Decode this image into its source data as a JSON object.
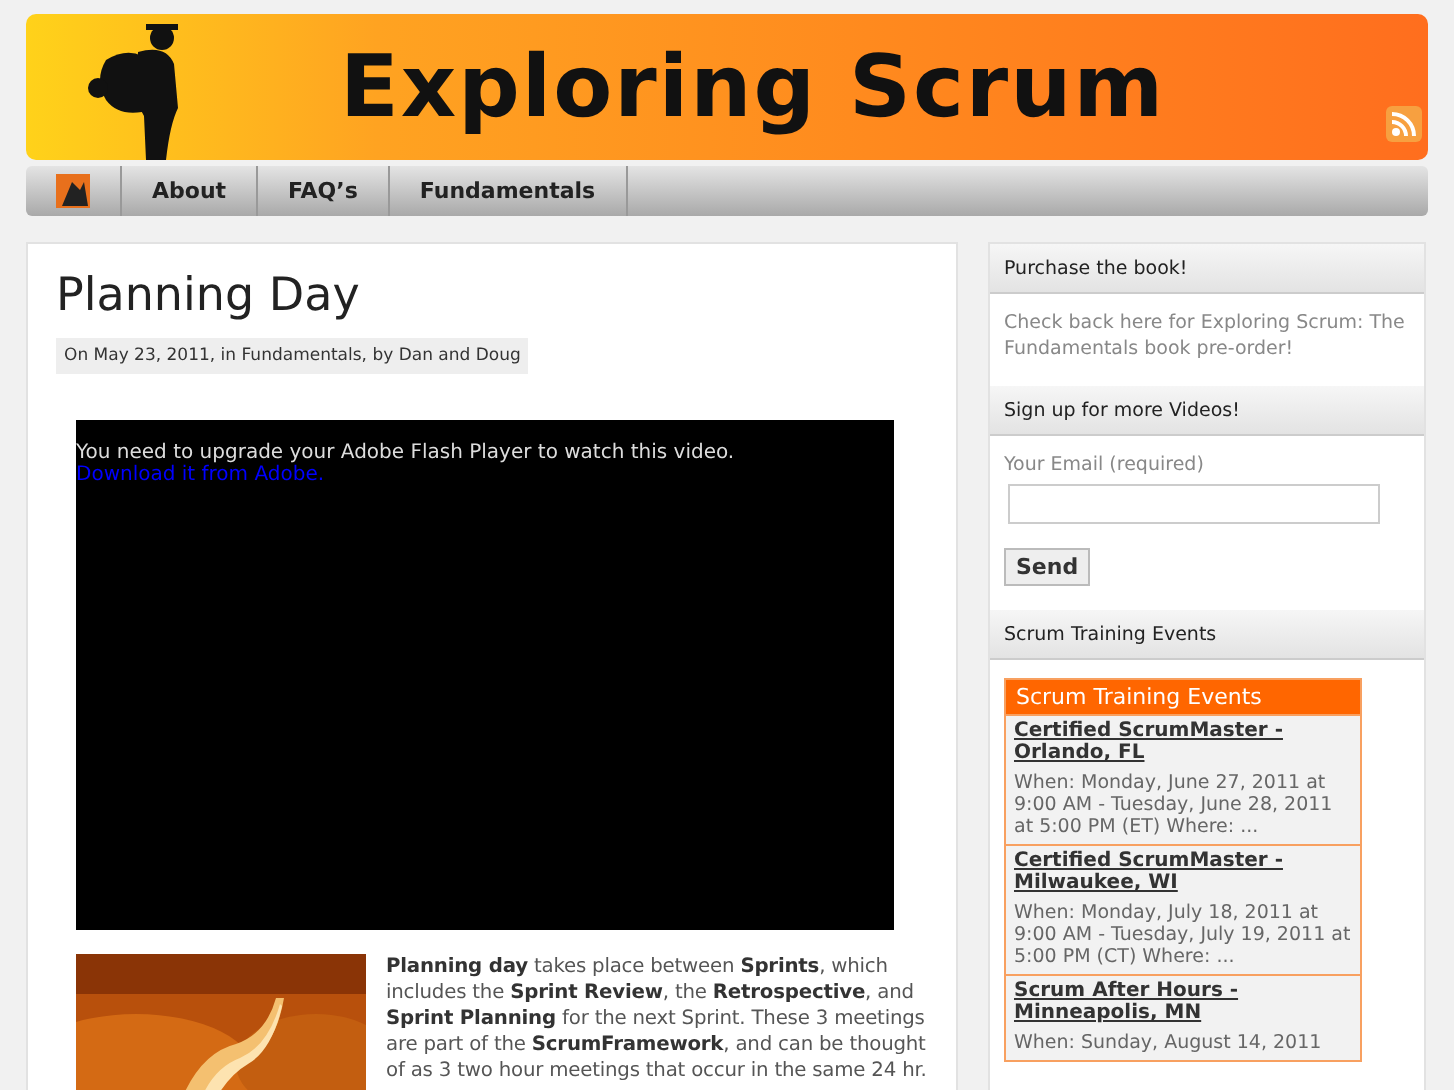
{
  "header": {
    "title": "Exploring Scrum"
  },
  "nav": {
    "items": [
      {
        "label": "About"
      },
      {
        "label": "FAQ’s"
      },
      {
        "label": "Fundamentals"
      }
    ]
  },
  "post": {
    "title": "Planning Day",
    "meta": "On May 23, 2011, in Fundamentals, by Dan and Doug",
    "video": {
      "message": "You need to upgrade your Adobe Flash Player to watch this video.",
      "link": "Download it from Adobe."
    },
    "body": "**Planning day** takes place between **Sprints**, which includes the **Sprint Review**, the **Retrospective**, and **Sprint Planning** for the next Sprint. These 3 meetings are part of the **ScrumFramework**, and can be thought of as 3 two hour meetings that occur in the same 24 hr."
  },
  "sidebar": [
    {
      "kind": "text",
      "title": "Purchase the book!",
      "text": "Check back here for Exploring Scrum: The Fundamentals book pre-order!"
    },
    {
      "kind": "form",
      "title": "Sign up for more Videos!",
      "label": "Your Email (required)",
      "button": "Send"
    },
    {
      "kind": "events",
      "title": "Scrum Training Events",
      "box_title": "Scrum Training Events",
      "events": [
        {
          "title": "Certified ScrumMaster - Orlando, FL",
          "when": "When: Monday, June 27, 2011 at 9:00 AM - Tuesday, June 28, 2011 at 5:00 PM (ET) Where: ..."
        },
        {
          "title": "Certified ScrumMaster - Milwaukee, WI",
          "when": "When: Monday, July 18, 2011 at 9:00 AM - Tuesday, July 19, 2011 at 5:00 PM (CT) Where: ..."
        },
        {
          "title": "Scrum After Hours - Minneapolis, MN",
          "when": "When: Sunday, August 14, 2011"
        }
      ]
    }
  ]
}
